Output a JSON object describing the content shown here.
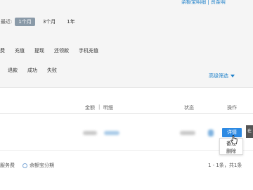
{
  "header": {
    "top_link": "余额宝明细 | 资金明"
  },
  "filters": {
    "period_label": "最近:",
    "periods": [
      {
        "label": "1个月",
        "active": true
      },
      {
        "label": "3个月",
        "active": false
      },
      {
        "label": "1年",
        "active": false
      }
    ],
    "types": [
      "费",
      "充值",
      "提现",
      "还领款",
      "手机充值"
    ],
    "statuses": [
      "退款",
      "成功",
      "失败"
    ],
    "advanced_filter": "高级筛选"
  },
  "table": {
    "headers": {
      "amount": "金额",
      "separator": "|",
      "detail": "明细",
      "status": "状态",
      "action": "操作"
    }
  },
  "action_menu": {
    "button": "详情",
    "items": [
      "备注",
      "删除"
    ],
    "side_tab": "在"
  },
  "footer": {
    "legend_service_fee": "服务费",
    "legend_yuebao": "余额宝分期",
    "pagination": "1 - 1条，共1条"
  },
  "colors": {
    "accent": "#1e80c9",
    "button": "#2d8ae3",
    "chip_active": "#8a9aa8"
  }
}
